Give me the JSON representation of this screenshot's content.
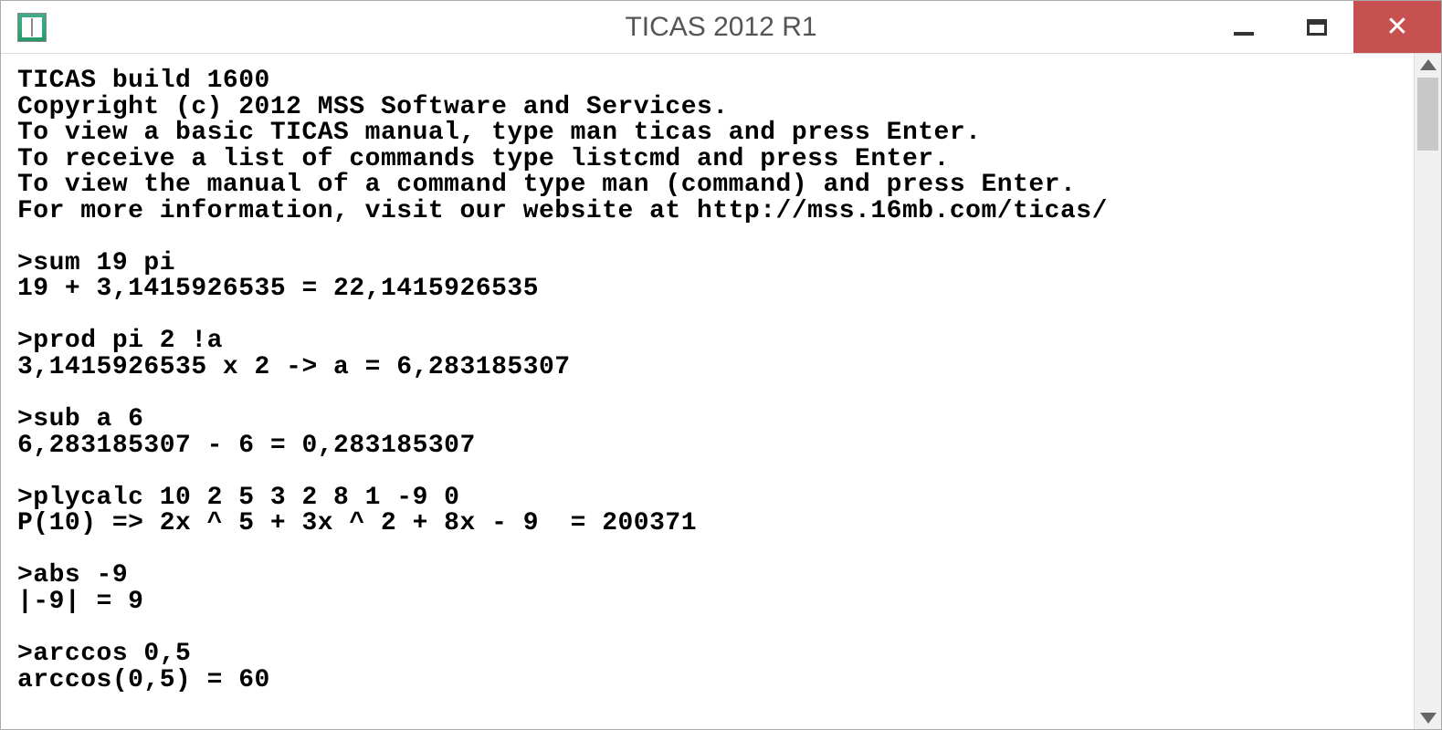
{
  "window": {
    "title": "TICAS 2012 R1"
  },
  "header": {
    "line1": "TICAS build 1600",
    "line2": "Copyright (c) 2012 MSS Software and Services.",
    "line3": "To view a basic TICAS manual, type man ticas and press Enter.",
    "line4": "To receive a list of commands type listcmd and press Enter.",
    "line5": "To view the manual of a command type man (command) and press Enter.",
    "line6": "For more information, visit our website at http://mss.16mb.com/ticas/"
  },
  "session": {
    "cmd1": ">sum 19 pi",
    "out1": "19 + 3,1415926535 = 22,1415926535",
    "cmd2": ">prod pi 2 !a",
    "out2": "3,1415926535 x 2 -> a = 6,283185307",
    "cmd3": ">sub a 6",
    "out3": "6,283185307 - 6 = 0,283185307",
    "cmd4": ">plycalc 10 2 5 3 2 8 1 -9 0",
    "out4": "P(10) => 2x ^ 5 + 3x ^ 2 + 8x - 9  = 200371",
    "cmd5": ">abs -9",
    "out5": "|-9| = 9",
    "cmd6": ">arccos 0,5",
    "out6": "arccos(0,5) = 60"
  }
}
